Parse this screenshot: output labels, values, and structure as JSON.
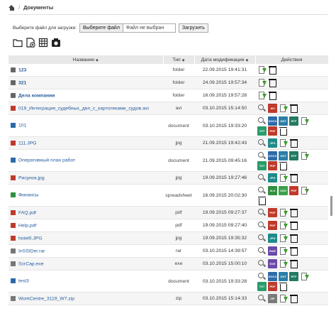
{
  "breadcrumb": {
    "separator": "/",
    "current": "Документы"
  },
  "upload": {
    "label": "Выберите файл для загрузки:",
    "choose_label": "Выберите файл",
    "no_file": "Файл не выбран",
    "submit_label": "Загрузить"
  },
  "table": {
    "headers": {
      "name": "Название",
      "type": "Тип",
      "date": "Дата модификации",
      "actions": "Действия"
    },
    "rows": [
      {
        "name": "123",
        "type": "folder",
        "date": "22.09.2015 19:41:31",
        "kind": "folder",
        "bold": true,
        "actions": [
          "dl",
          "trash"
        ]
      },
      {
        "name": "321",
        "type": "folder",
        "date": "24.09.2015 19:57:34",
        "kind": "folder",
        "bold": true,
        "actions": [
          "dl",
          "trash"
        ]
      },
      {
        "name": "Дела компании",
        "type": "folder",
        "date": "16.09.2015 19:57:28",
        "kind": "folder",
        "bold": true,
        "actions": [
          "dl",
          "trash"
        ]
      },
      {
        "name": "019_Интеграция_судебных_дел_с_картотеками_судов.avi",
        "type": "avi",
        "date": "03.10.2015 15:14:50",
        "kind": "video",
        "bold": false,
        "actions": [
          "mag",
          "AVI",
          "dl",
          "trash"
        ]
      },
      {
        "name": "101",
        "type": "document",
        "date": "03.10.2015 19:33:20",
        "kind": "doc",
        "bold": false,
        "actions": [
          "mag",
          "DOCX",
          "ODT",
          "RTF",
          "dl",
          "TXT",
          "PDF",
          "trash"
        ]
      },
      {
        "name": "111.JPG",
        "type": "jpg",
        "date": "21.09.2015 19:42:43",
        "kind": "image",
        "bold": false,
        "actions": [
          "mag",
          "JPG",
          "dl",
          "trash"
        ]
      },
      {
        "name": "Оперативный план работ",
        "type": "document",
        "date": "21.09.2015 09:45:16",
        "kind": "doc",
        "bold": false,
        "actions": [
          "mag",
          "DOCX",
          "ODT",
          "RTF",
          "dl",
          "TXT",
          "PDF",
          "trash"
        ]
      },
      {
        "name": "Рисунок.jpg",
        "type": "jpg",
        "date": "19.09.2015 19:27:46",
        "kind": "image",
        "bold": false,
        "actions": [
          "mag",
          "JPG",
          "dl",
          "trash"
        ]
      },
      {
        "name": "Финансы",
        "type": "spreadsheet",
        "date": "16.09.2015 20:02:30",
        "kind": "sheet",
        "bold": false,
        "actions": [
          "mag",
          "XLS",
          "ODS",
          "PDF",
          "dl",
          "trash"
        ]
      },
      {
        "name": "FAQ.pdf",
        "type": "pdf",
        "date": "19.09.2015 09:27:37",
        "kind": "pdf",
        "bold": false,
        "actions": [
          "mag",
          "PDF",
          "dl",
          "trash"
        ]
      },
      {
        "name": "Help.pdf",
        "type": "pdf",
        "date": "19.09.2015 09:27:40",
        "kind": "pdf",
        "bold": false,
        "actions": [
          "mag",
          "PDF",
          "dl",
          "trash"
        ]
      },
      {
        "name": "hotel0.JPG",
        "type": "jpg",
        "date": "19.09.2015 19:35:32",
        "kind": "image",
        "bold": false,
        "actions": [
          "mag",
          "JPG",
          "dl",
          "trash"
        ]
      },
      {
        "name": "InSSIDer.rar",
        "type": "rar",
        "date": "03.10.2015 14:39:57",
        "kind": "archive",
        "bold": false,
        "actions": [
          "mag",
          "RAR",
          "dl",
          "trash"
        ]
      },
      {
        "name": "ScrCap.exe",
        "type": "exe",
        "date": "03.10.2015 15:00:10",
        "kind": "exe",
        "bold": false,
        "actions": [
          "mag",
          "EXE",
          "dl",
          "trash"
        ]
      },
      {
        "name": "test3",
        "type": "document",
        "date": "03.10.2015 19:33:28",
        "kind": "doc",
        "bold": false,
        "actions": [
          "mag",
          "DOCX",
          "ODT",
          "RTF",
          "dl",
          "TXT",
          "PDF",
          "trash"
        ]
      },
      {
        "name": "WorkCentre_3119_W7.zip",
        "type": "zip",
        "date": "03.10.2015 15:14:33",
        "kind": "archive",
        "bold": false,
        "actions": [
          "mag",
          "ZIP",
          "dl",
          "trash"
        ]
      }
    ]
  }
}
